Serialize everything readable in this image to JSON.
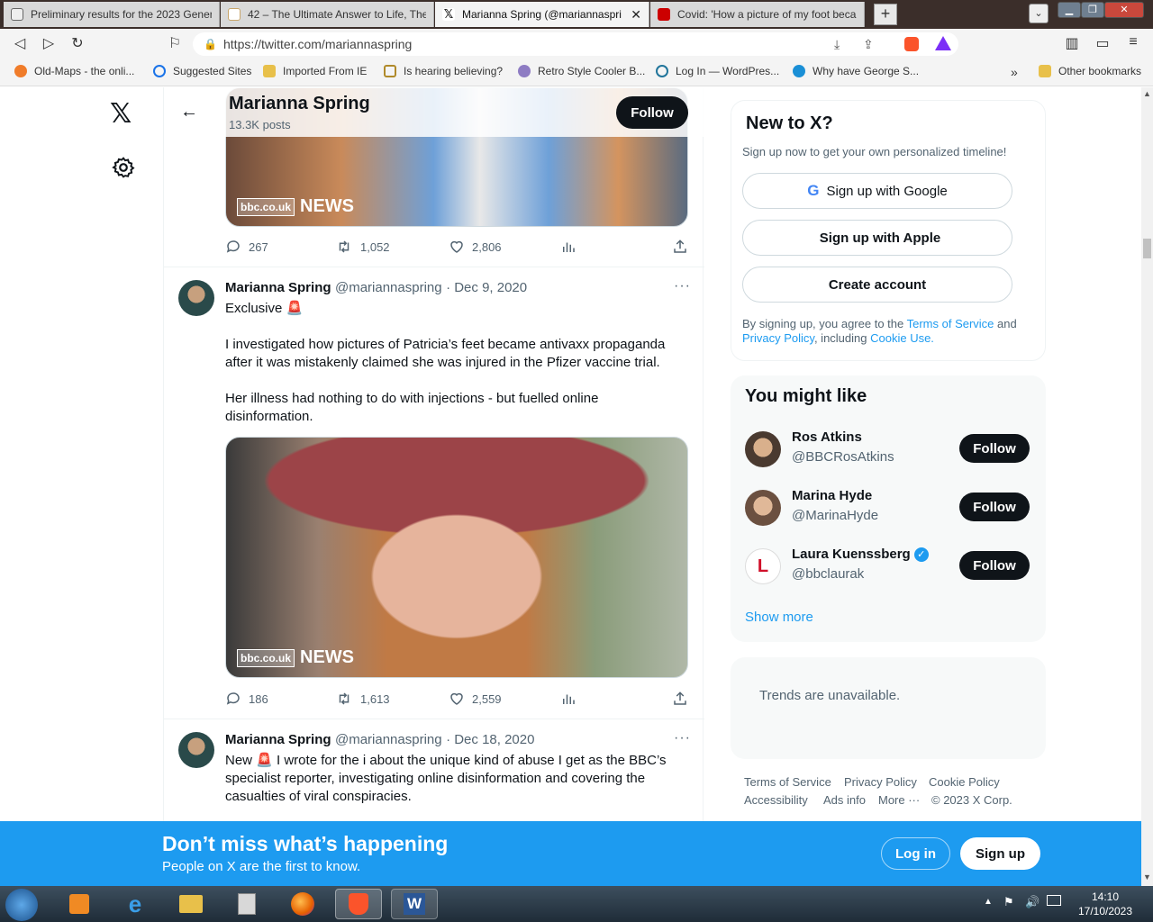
{
  "browser": {
    "tabs": [
      {
        "title": "Preliminary results for the 2023 Gener",
        "active": false
      },
      {
        "title": "42 – The Ultimate Answer to Life, The",
        "active": false
      },
      {
        "title": "Marianna Spring (@mariannaspri",
        "active": true
      },
      {
        "title": "Covid: 'How a picture of my foot beca",
        "active": false
      }
    ],
    "url": "https://twitter.com/mariannaspring",
    "bookmarks": [
      "Old-Maps - the onli...",
      "Suggested Sites",
      "Imported From IE",
      "Is hearing believing?",
      "Retro Style Cooler B...",
      "Log In — WordPres...",
      "Why have George S...",
      "Other bookmarks"
    ],
    "more_bookmarks": "»"
  },
  "profile": {
    "name": "Marianna Spring",
    "posts": "13.3K posts",
    "follow_label": "Follow"
  },
  "tweets": [
    {
      "media_label": "NEWS",
      "media_source": "bbc.co.uk",
      "replies": "267",
      "retweets": "1,052",
      "likes": "2,806"
    },
    {
      "name": "Marianna Spring",
      "handle": "@mariannaspring",
      "date": "· Dec 9, 2020",
      "line1": "Exclusive 🚨",
      "line2": "I investigated how pictures of Patricia’s feet became antivaxx propaganda after it was mistakenly claimed she was injured in the Pfizer vaccine trial.",
      "line3": "Her illness had nothing to do with injections - but fuelled online disinformation.",
      "media_label": "NEWS",
      "media_source": "bbc.co.uk",
      "replies": "186",
      "retweets": "1,613",
      "likes": "2,559"
    },
    {
      "name": "Marianna Spring",
      "handle": "@mariannaspring",
      "date": "· Dec 18, 2020",
      "text": "New 🚨 I wrote for the i about the unique kind of abuse I get as the BBC’s specialist reporter, investigating online disinformation and covering the casualties of viral conspiracies."
    }
  ],
  "signup": {
    "title": "New to X?",
    "subtitle": "Sign up now to get your own personalized timeline!",
    "google": "Sign up with Google",
    "apple": "Sign up with Apple",
    "create": "Create account",
    "terms_pre": "By signing up, you agree to the ",
    "terms": "Terms of Service",
    "and": " and ",
    "privacy": "Privacy Policy",
    "including": ", including ",
    "cookie": "Cookie Use."
  },
  "might_like": {
    "title": "You might like",
    "users": [
      {
        "name": "Ros Atkins",
        "handle": "@BBCRosAtkins",
        "verified": false
      },
      {
        "name": "Marina Hyde",
        "handle": "@MarinaHyde",
        "verified": false
      },
      {
        "name": "Laura Kuenssberg",
        "handle": "@bbclaurak",
        "verified": true
      }
    ],
    "follow_label": "Follow",
    "show_more": "Show more"
  },
  "trends": {
    "text": "Trends are unavailable."
  },
  "footer": {
    "terms": "Terms of Service",
    "privacy": "Privacy Policy",
    "cookie": "Cookie Policy",
    "accessibility": "Accessibility",
    "ads": "Ads info",
    "more": "More ···",
    "copyright": "© 2023 X Corp."
  },
  "banner": {
    "title": "Don’t miss what’s happening",
    "subtitle": "People on X are the first to know.",
    "login": "Log in",
    "signup": "Sign up"
  },
  "taskbar": {
    "time": "14:10",
    "date": "17/10/2023"
  },
  "colors": {
    "accent": "#1d9bf0",
    "text": "#0f1419",
    "muted": "#536471"
  }
}
